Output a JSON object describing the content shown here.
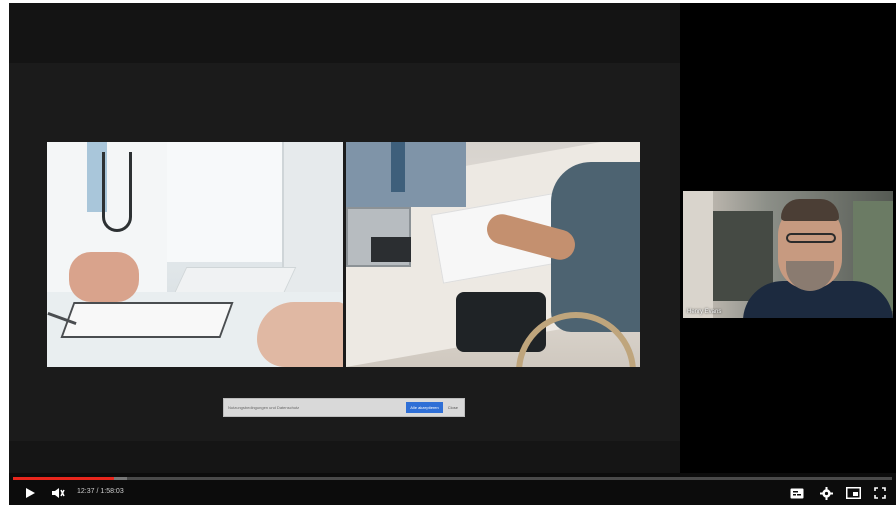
{
  "player": {
    "main_slide": {
      "consent_bar": {
        "message": "Nutzungsbedingungen und Datenschutz",
        "accept_label": "Alle akzeptieren",
        "close_label": "Close"
      }
    },
    "speaker": {
      "name_label": "Henry Evans"
    },
    "controls": {
      "time_display": "12:37 / 1:58:03",
      "progress_played_fraction": 0.115,
      "progress_loaded_fraction": 0.13,
      "icons": {
        "play": "play-icon",
        "mute": "volume-muted-icon",
        "subtitles": "subtitles-icon",
        "settings": "gear-icon",
        "miniplayer": "miniplayer-icon",
        "fullscreen": "fullscreen-icon"
      }
    },
    "colors": {
      "progress_red": "#e8261c",
      "accept_blue": "#2f6fd6",
      "control_bg": "#0c0c0c"
    }
  }
}
